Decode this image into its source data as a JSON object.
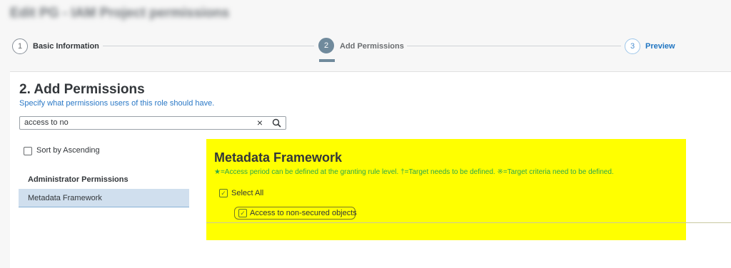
{
  "header": {
    "title": "Edit PG - IAM Project permissions"
  },
  "stepper": {
    "steps": [
      {
        "number": "1",
        "label": "Basic Information",
        "state": "done"
      },
      {
        "number": "2",
        "label": "Add Permissions",
        "state": "active"
      },
      {
        "number": "3",
        "label": "Preview",
        "state": "next"
      }
    ]
  },
  "section": {
    "title": "2. Add Permissions",
    "subtitle": "Specify what permissions users of this role should have."
  },
  "search": {
    "value": "access to no",
    "clear_icon": "clear-icon",
    "search_icon": "search-icon",
    "clear_glyph": "×"
  },
  "sort": {
    "label": "Sort by Ascending",
    "checked": false
  },
  "categories": {
    "header": "Administrator Permissions",
    "items": [
      {
        "label": "Metadata Framework",
        "selected": true
      }
    ]
  },
  "detail": {
    "title": "Metadata Framework",
    "legend": "★=Access period can be defined at the granting rule level.  †=Target needs to be defined.  ※=Target criteria need to be defined.",
    "select_all_label": "Select All",
    "select_all_checked": true,
    "permissions": [
      {
        "label": "Access to non-secured objects",
        "checked": true
      }
    ],
    "check_glyph": "✓",
    "highlight_color": "#ffff00",
    "legend_color": "#2ea84a"
  }
}
